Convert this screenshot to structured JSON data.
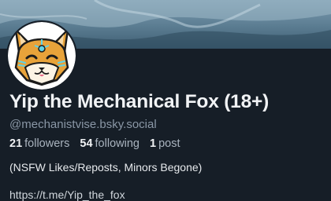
{
  "profile": {
    "display_name": "Yip the Mechanical Fox (18+)",
    "handle": "@mechanistvise.bsky.social",
    "bio": "(NSFW Likes/Reposts, Minors Begone)",
    "link": "https://t.me/Yip_the_fox"
  },
  "stats": {
    "followers_count": "21",
    "followers_label": "followers",
    "following_count": "54",
    "following_label": "following",
    "posts_count": "1",
    "posts_label": "post"
  },
  "colors": {
    "background": "#161e27",
    "fox_orange": "#e8a33a",
    "accent_cyan": "#5fd3e6"
  },
  "icons": {
    "avatar": "fox-avatar-icon"
  }
}
